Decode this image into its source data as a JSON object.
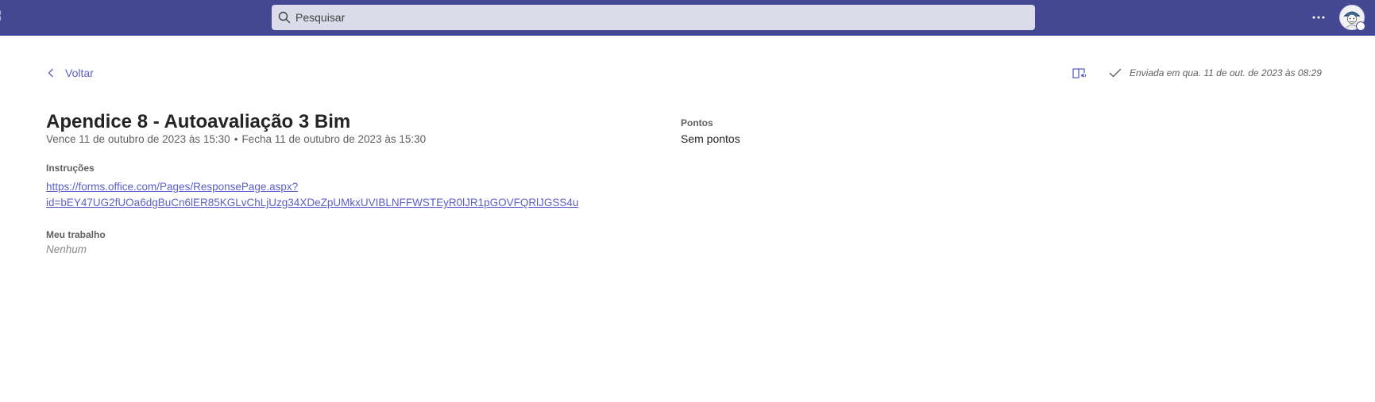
{
  "header": {
    "search": {
      "placeholder": "Pesquisar"
    },
    "icons": {
      "search": "search-icon",
      "more": "more-options-icon",
      "avatar": "user-avatar",
      "apps": "apps-grid-icon"
    },
    "colors": {
      "topbar": "#444791",
      "search_bg": "#dbdbe9",
      "accent": "#5b5fc7"
    }
  },
  "toolbar": {
    "back_label": "Voltar",
    "submitted_text": "Enviada em qua. 11 de out. de 2023 às 08:29",
    "icons": {
      "back": "chevron-left-icon",
      "immersive_reader": "immersive-reader-icon",
      "submitted": "checkmark-icon"
    }
  },
  "assignment": {
    "title": "Apendice 8 - Autoavaliação 3 Bim",
    "due": "Vence 11 de outubro de 2023 às 15:30",
    "separator": "•",
    "closes": "Fecha 11 de outubro de 2023 às 15:30",
    "points_label": "Pontos",
    "points_value": "Sem pontos",
    "instructions_label": "Instruções",
    "instructions_link_line1": "https://forms.office.com/Pages/ResponsePage.aspx?",
    "instructions_link_line2": "id=bEY47UG2fUOa6dgBuCn6lER85KGLvChLjUzg34XDeZpUMkxUVIBLNFFWSTEyR0lJR1pGOVFQRlJGSS4u",
    "my_work_label": "Meu trabalho",
    "my_work_value": "Nenhum"
  }
}
